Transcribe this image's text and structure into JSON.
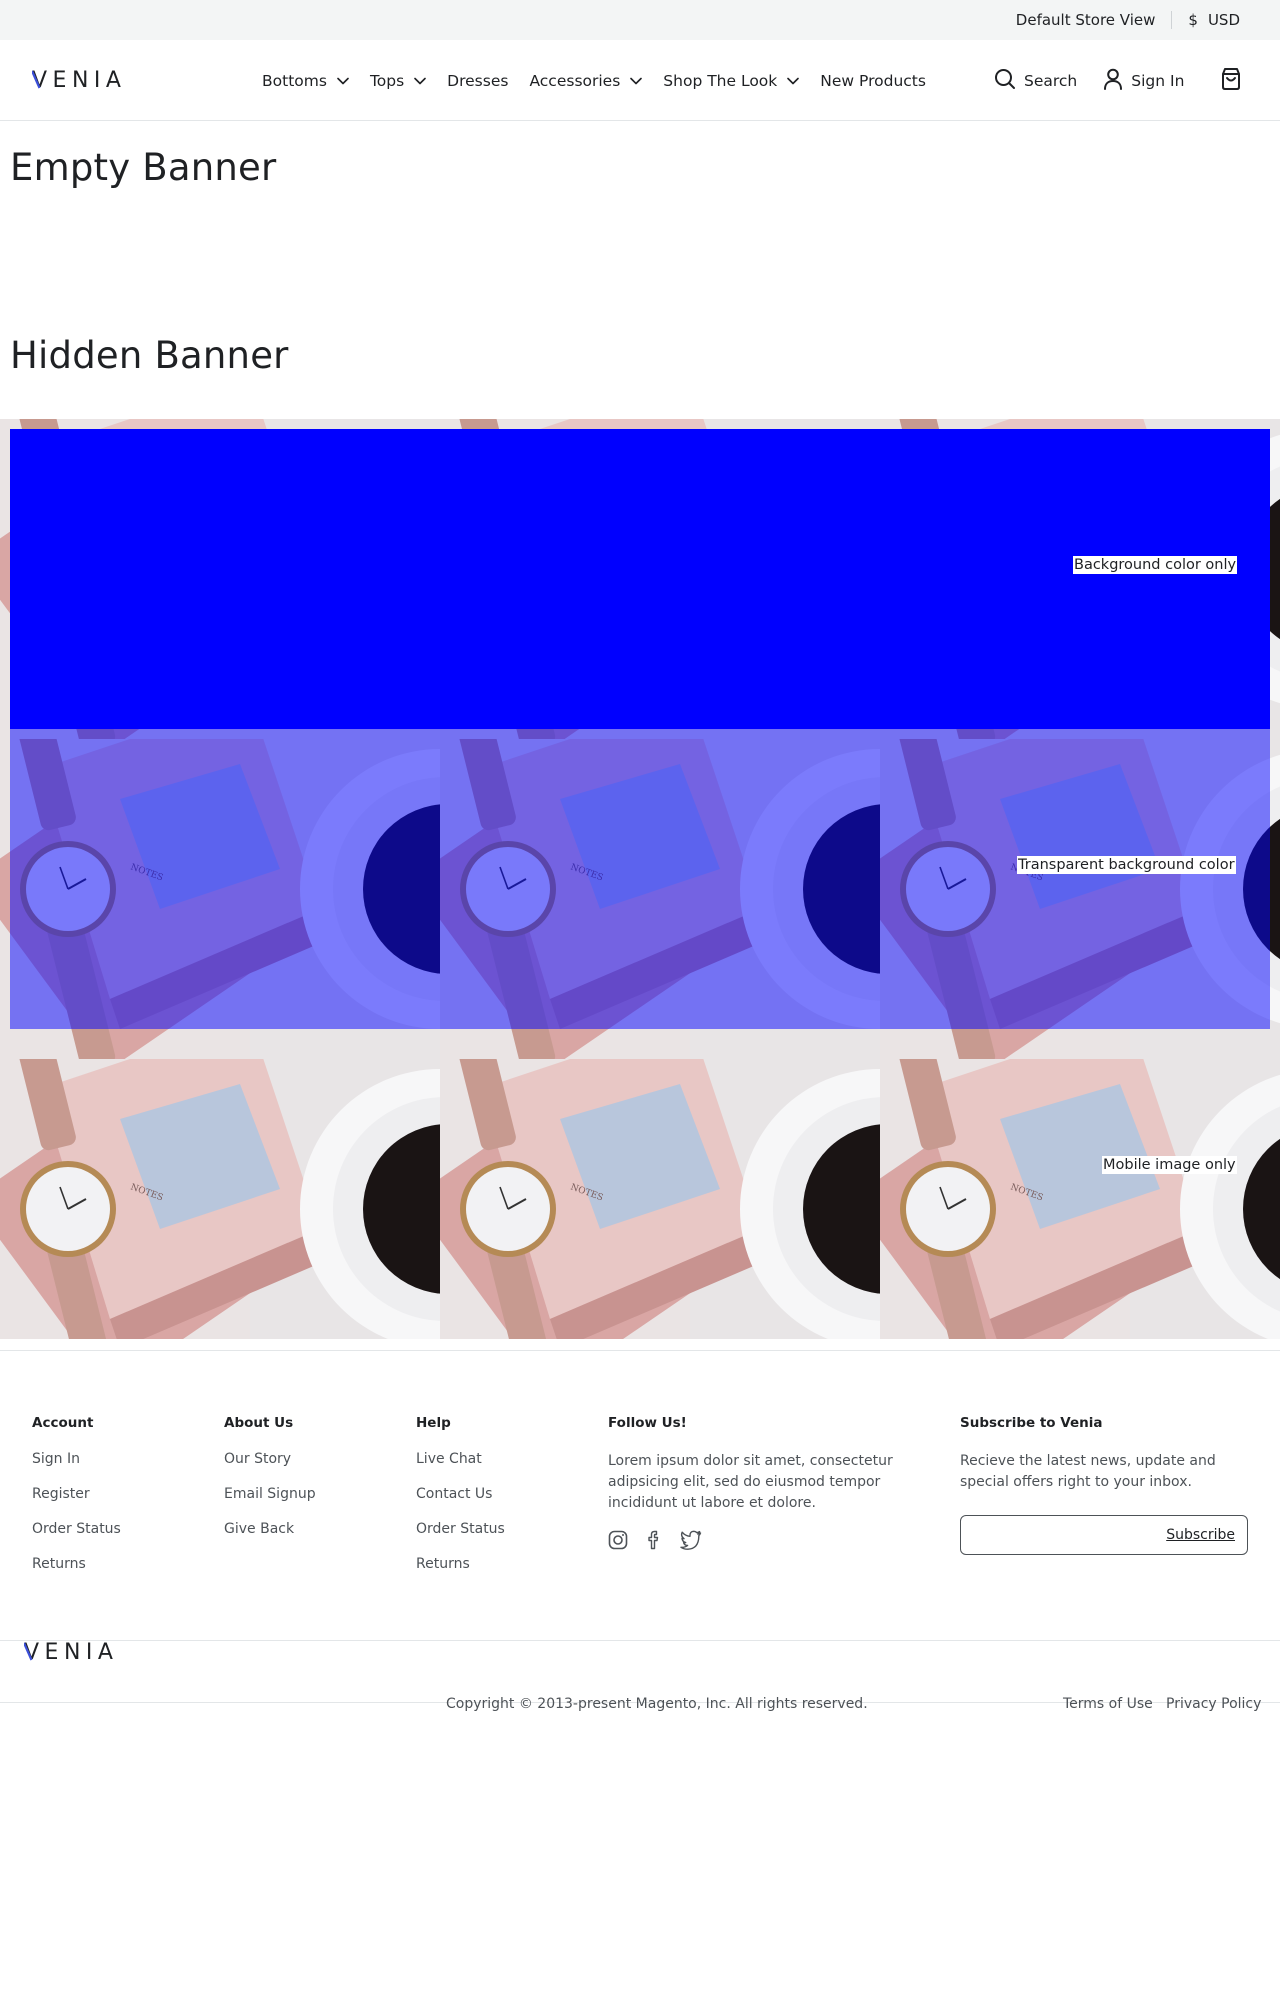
{
  "topbar": {
    "store": "Default Store View",
    "currency_symbol": "$",
    "currency": "USD"
  },
  "header": {
    "brand": "VENIA",
    "nav": [
      {
        "label": "Bottoms",
        "has_menu": true
      },
      {
        "label": "Tops",
        "has_menu": true
      },
      {
        "label": "Dresses",
        "has_menu": false
      },
      {
        "label": "Accessories",
        "has_menu": true
      },
      {
        "label": "Shop The Look",
        "has_menu": true
      },
      {
        "label": "New Products",
        "has_menu": false
      }
    ],
    "search_label": "Search",
    "signin_label": "Sign In",
    "icons": {
      "search": "search-icon",
      "account": "user-icon",
      "cart": "cart-bag-icon"
    },
    "brand_accent": "#3b4fd8"
  },
  "content": {
    "empty_title": "Empty Banner",
    "hidden_title": "Hidden Banner",
    "banners": {
      "bg_color": {
        "label": "Background color only",
        "color": "#0000ff"
      },
      "transparent": {
        "label": "Transparent background color",
        "color": "rgba(0,0,255,0.5)"
      },
      "mobile": {
        "label": "Mobile image only"
      }
    }
  },
  "footer": {
    "columns": [
      {
        "title": "Account",
        "links": [
          "Sign In",
          "Register",
          "Order Status",
          "Returns"
        ]
      },
      {
        "title": "About Us",
        "links": [
          "Our Story",
          "Email Signup",
          "Give Back"
        ]
      },
      {
        "title": "Help",
        "links": [
          "Live Chat",
          "Contact Us",
          "Order Status",
          "Returns"
        ]
      }
    ],
    "follow": {
      "title": "Follow Us!",
      "text": "Lorem ipsum dolor sit amet, consectetur adipsicing elit, sed do eiusmod tempor incididunt ut labore et dolore.",
      "icons": [
        "instagram-icon",
        "facebook-icon",
        "twitter-icon"
      ]
    },
    "subscribe": {
      "title": "Subscribe to Venia",
      "text": "Recieve the latest news, update and special offers right to your inbox.",
      "button": "Subscribe"
    },
    "brand": "VENIA",
    "copyright": "Copyright © 2013-present Magento, Inc. All rights reserved.",
    "terms": "Terms of Use",
    "privacy": "Privacy Policy"
  }
}
